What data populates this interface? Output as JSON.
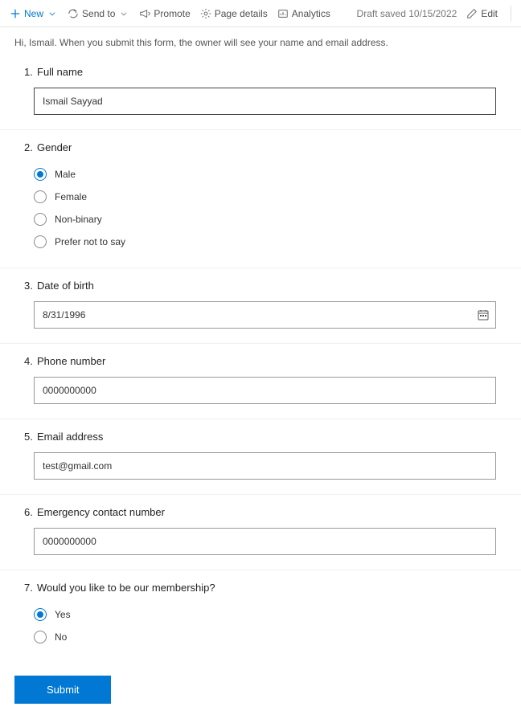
{
  "toolbar": {
    "new_label": "New",
    "sendto_label": "Send to",
    "promote_label": "Promote",
    "pagedetails_label": "Page details",
    "analytics_label": "Analytics",
    "draft_label": "Draft saved 10/15/2022",
    "edit_label": "Edit"
  },
  "intro": "Hi, Ismail. When you submit this form, the owner will see your name and email address.",
  "questions": {
    "q1": {
      "num": "1.",
      "label": "Full name",
      "value": "Ismail Sayyad"
    },
    "q2": {
      "num": "2.",
      "label": "Gender",
      "options": {
        "o1": "Male",
        "o2": "Female",
        "o3": "Non-binary",
        "o4": "Prefer not to say"
      },
      "selected": "o1"
    },
    "q3": {
      "num": "3.",
      "label": "Date of birth",
      "value": "8/31/1996"
    },
    "q4": {
      "num": "4.",
      "label": "Phone number",
      "value": "0000000000"
    },
    "q5": {
      "num": "5.",
      "label": "Email address",
      "value": "test@gmail.com"
    },
    "q6": {
      "num": "6.",
      "label": "Emergency contact number",
      "value": "0000000000"
    },
    "q7": {
      "num": "7.",
      "label": "Would you like to be our membership?",
      "options": {
        "o1": "Yes",
        "o2": "No"
      },
      "selected": "o1"
    }
  },
  "submit_label": "Submit"
}
